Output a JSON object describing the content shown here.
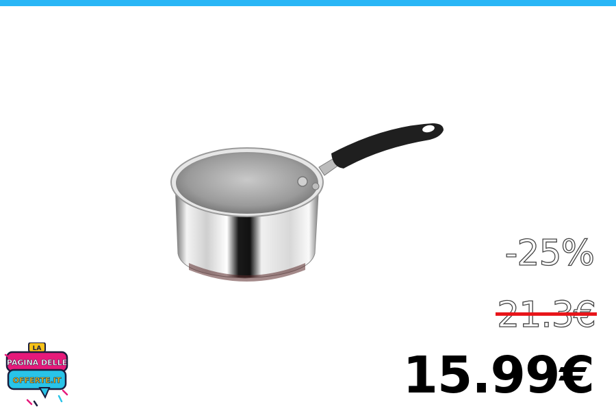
{
  "colors": {
    "accent_bar": "#29b6f6",
    "strike": "#e8151a",
    "logo_pink": "#e6197a",
    "logo_cyan": "#29c4e8",
    "logo_yellow": "#f6c21a",
    "logo_dark": "#1b1d3d"
  },
  "product": {
    "icon": "saucepan-image"
  },
  "pricing": {
    "discount": "-25%",
    "old_price": "21.3€",
    "new_price": "15.99€"
  },
  "logo": {
    "line1": "LA",
    "line2": "PAGINA DELLE",
    "line3": "OFFERTE.IT"
  }
}
